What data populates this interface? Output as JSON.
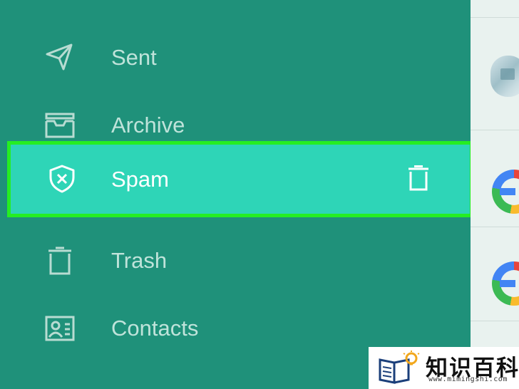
{
  "drawer": {
    "items": [
      {
        "label": "",
        "icon": "inbox-icon"
      },
      {
        "label": "Sent",
        "icon": "paper-plane-icon"
      },
      {
        "label": "Archive",
        "icon": "archive-box-icon"
      },
      {
        "label": "Spam",
        "icon": "shield-x-icon",
        "selected": true,
        "action_icon": "trash-icon"
      },
      {
        "label": "Trash",
        "icon": "trash-icon"
      },
      {
        "label": "Contacts",
        "icon": "contact-card-icon"
      }
    ]
  },
  "colors": {
    "drawer_background": "#1f917a",
    "selected_background": "#2ed5b7",
    "highlight_border": "#25ee22",
    "label_text": "#bfe3da",
    "selected_text": "#ffffff"
  },
  "watermark": {
    "title": "知识百科",
    "url": "www.mimingshi.com"
  }
}
